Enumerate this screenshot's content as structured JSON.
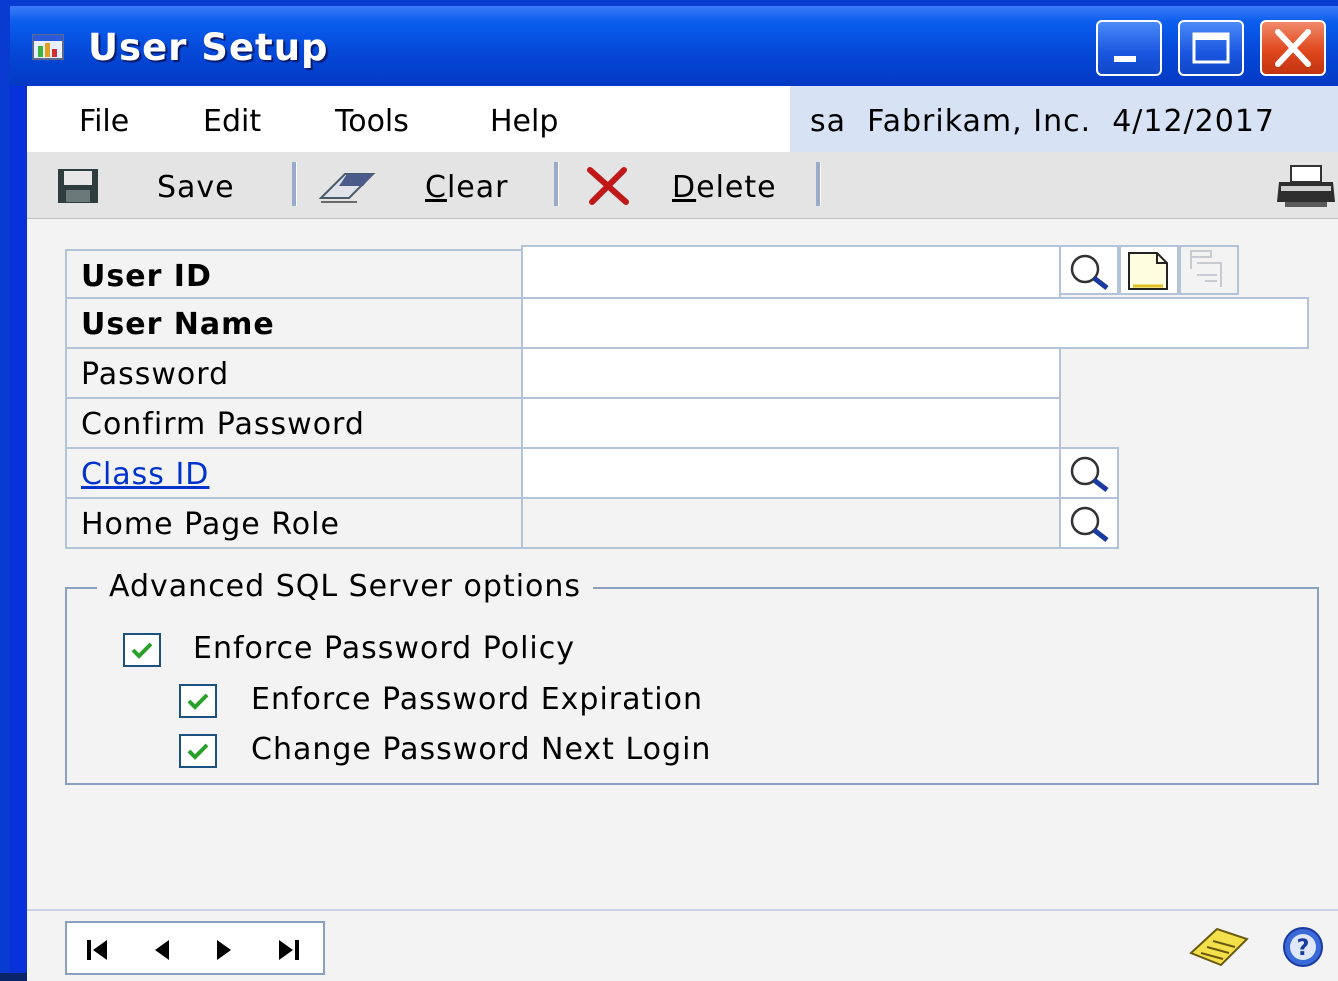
{
  "window": {
    "title": "User Setup"
  },
  "menu": {
    "items": [
      "File",
      "Edit",
      "Tools",
      "Help"
    ]
  },
  "info": {
    "user": "sa",
    "company": "Fabrikam, Inc.",
    "date": "4/12/2017"
  },
  "toolbar": {
    "save_label": "Save",
    "clear_label": "Clear",
    "delete_label": "Delete"
  },
  "form": {
    "user_id_label": "User ID",
    "user_name_label": "User Name",
    "password_label": "Password",
    "confirm_password_label": "Confirm Password",
    "class_id_label": "Class ID",
    "home_page_role_label": "Home Page Role",
    "user_id_value": "",
    "user_name_value": "",
    "password_value": "",
    "confirm_password_value": "",
    "class_id_value": "",
    "home_page_role_value": ""
  },
  "advanced": {
    "title": "Advanced SQL Server options",
    "enforce_policy": {
      "label": "Enforce Password Policy",
      "checked": true
    },
    "enforce_expiration": {
      "label": "Enforce Password Expiration",
      "checked": true
    },
    "change_next_login": {
      "label": "Change Password Next Login",
      "checked": true
    }
  },
  "icons": {
    "window": "app-window-icon",
    "save": "save-icon",
    "clear": "eraser-icon",
    "delete": "delete-x-icon",
    "print": "printer-icon",
    "lookup": "magnifier-icon",
    "new": "new-document-icon",
    "note": "note-icon",
    "help": "help-icon",
    "checkmark": "checkmark-icon"
  },
  "colors": {
    "titlebar": "#0547d6",
    "link": "#0033cc",
    "check": "#2aa12a",
    "close": "#e0481e"
  }
}
